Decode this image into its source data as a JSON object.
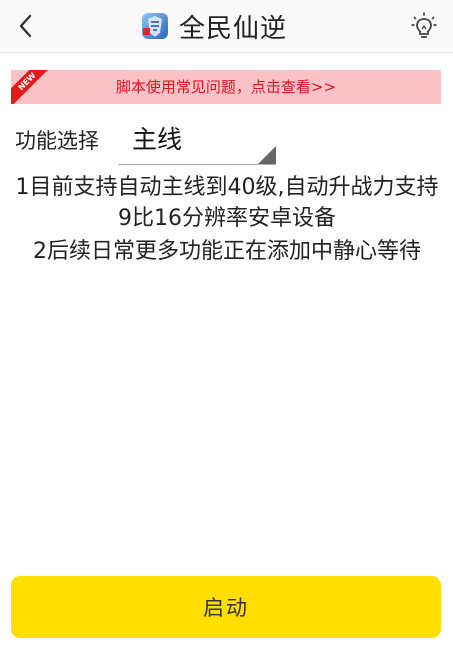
{
  "header": {
    "title": "全民仙逆",
    "back_icon": "chevron-left-icon",
    "idea_icon": "lightbulb-icon",
    "logo": "app-logo"
  },
  "notice": {
    "badge": "NEW",
    "text": "脚本使用常见问题，点击查看>>",
    "bg_color": "#f9c2c7",
    "text_color": "#e4121f"
  },
  "function_select": {
    "label": "功能选择",
    "selected": "主线"
  },
  "info": {
    "lines": [
      "1目前支持自动主线到40级,自动升战力支持9比16分辨率安卓设备",
      "2后续日常更多功能正在添加中静心等待"
    ]
  },
  "actions": {
    "start_label": "启动",
    "start_color": "#ffde00"
  }
}
